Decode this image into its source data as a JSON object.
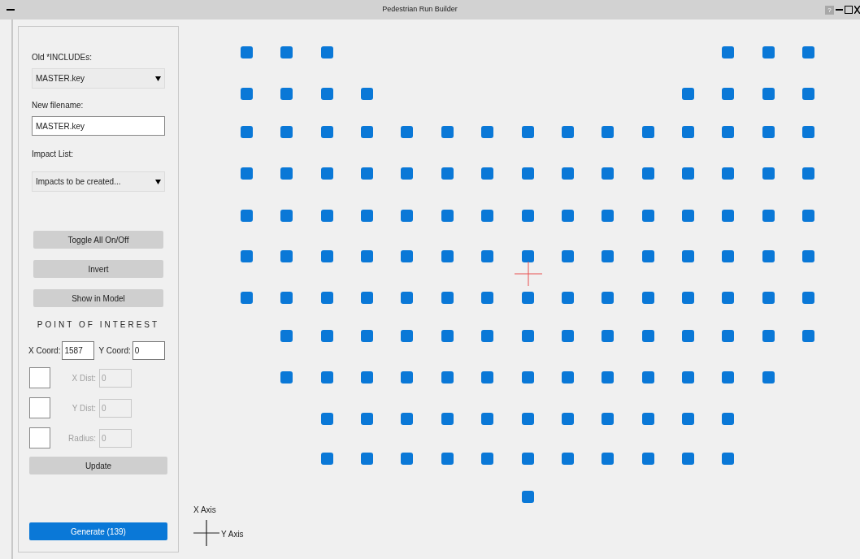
{
  "window": {
    "title": "Pedestrian Run Builder",
    "help": "?"
  },
  "panel": {
    "old_includes": {
      "label": "Old *INCLUDEs:",
      "value": "MASTER.key"
    },
    "new_filename": {
      "label": "New filename:",
      "value": "MASTER.key"
    },
    "impact_list": {
      "label": "Impact List:",
      "value": "Impacts to be created..."
    },
    "buttons": [
      "Toggle All On/Off",
      "Invert",
      "Show in Model"
    ],
    "poi": {
      "heading": "POINT OF INTEREST",
      "x_label": "X Coord:",
      "x_value": "1587",
      "y_label": "Y Coord:",
      "y_value": "0",
      "options": [
        {
          "label": "X Dist:",
          "value": "0",
          "checked": false,
          "disabled": true
        },
        {
          "label": "Y Dist:",
          "value": "0",
          "checked": false,
          "disabled": true
        },
        {
          "label": "Radius:",
          "value": "0",
          "checked": false,
          "disabled": true
        }
      ],
      "update": "Update"
    },
    "generate": "Generate (139)"
  },
  "grid": {
    "rows": [
      [
        true,
        true,
        true,
        false,
        false,
        false,
        false,
        false,
        false,
        false,
        false,
        false,
        true,
        true,
        true
      ],
      [
        true,
        true,
        true,
        true,
        false,
        false,
        false,
        false,
        false,
        false,
        false,
        true,
        true,
        true,
        true
      ],
      [
        true,
        true,
        true,
        true,
        true,
        true,
        true,
        true,
        true,
        true,
        true,
        true,
        true,
        true,
        true
      ],
      [
        true,
        true,
        true,
        true,
        true,
        true,
        true,
        true,
        true,
        true,
        true,
        true,
        true,
        true,
        true
      ],
      [
        true,
        true,
        true,
        true,
        true,
        true,
        true,
        true,
        true,
        true,
        true,
        true,
        true,
        true,
        true
      ],
      [
        true,
        true,
        true,
        true,
        true,
        true,
        true,
        true,
        true,
        true,
        true,
        true,
        true,
        true,
        true
      ],
      [
        true,
        true,
        true,
        true,
        true,
        true,
        true,
        true,
        true,
        true,
        true,
        true,
        true,
        true,
        true
      ],
      [
        false,
        true,
        true,
        true,
        true,
        true,
        true,
        true,
        true,
        true,
        true,
        true,
        true,
        true,
        true
      ],
      [
        false,
        true,
        true,
        true,
        true,
        true,
        true,
        true,
        true,
        true,
        true,
        true,
        true,
        true,
        false
      ],
      [
        false,
        false,
        true,
        true,
        true,
        true,
        true,
        true,
        true,
        true,
        true,
        true,
        true,
        false,
        false
      ],
      [
        false,
        false,
        true,
        true,
        true,
        true,
        true,
        true,
        true,
        true,
        true,
        true,
        true,
        false,
        false
      ],
      [
        false,
        false,
        false,
        false,
        false,
        false,
        false,
        true,
        false,
        false,
        false,
        false,
        false,
        false,
        false
      ]
    ]
  },
  "axes": {
    "x_label": "X Axis",
    "y_label": "Y Axis"
  }
}
